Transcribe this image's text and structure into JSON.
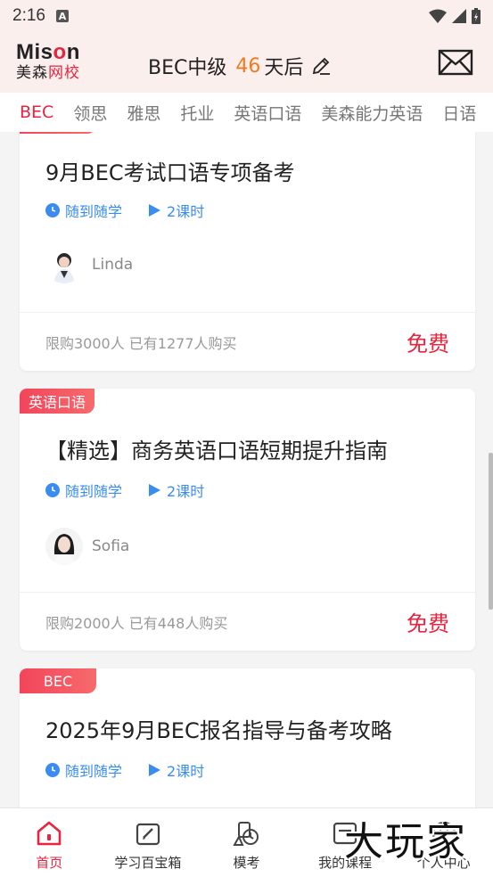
{
  "statusbar": {
    "time": "2:16",
    "a_icon": "A"
  },
  "header": {
    "logo_top": "Mison",
    "logo_bottom_a": "美森",
    "logo_bottom_b": "网校",
    "exam_name": "BEC中级",
    "days_number": "46",
    "days_suffix": "天后",
    "edit_icon": "pencil-icon",
    "mail_icon": "envelope-icon"
  },
  "tabs": [
    {
      "label": "BEC",
      "active": true
    },
    {
      "label": "领思"
    },
    {
      "label": "雅思"
    },
    {
      "label": "托业"
    },
    {
      "label": "英语口语"
    },
    {
      "label": "美森能力英语"
    },
    {
      "label": "日语"
    }
  ],
  "courses": [
    {
      "badge": "",
      "title": "9月BEC考试口语专项备考",
      "mode": "随到随学",
      "hours": "2课时",
      "teacher": "Linda",
      "sale": "限购3000人 已有1277人购买",
      "price": "免费"
    },
    {
      "badge": "英语口语",
      "title": "【精选】商务英语口语短期提升指南",
      "mode": "随到随学",
      "hours": "2课时",
      "teacher": "Sofia",
      "sale": "限购2000人 已有448人购买",
      "price": "免费"
    },
    {
      "badge": "BEC",
      "title": "2025年9月BEC报名指导与备考攻略",
      "mode": "随到随学",
      "hours": "2课时"
    }
  ],
  "nav": [
    {
      "label": "首页",
      "icon": "home-icon",
      "active": true
    },
    {
      "label": "学习百宝箱",
      "icon": "toolbox-icon"
    },
    {
      "label": "模考",
      "icon": "exam-icon"
    },
    {
      "label": "我的课程",
      "icon": "course-icon"
    },
    {
      "label": "个人中心",
      "icon": "profile-icon"
    }
  ],
  "watermark": "大玩家",
  "colors": {
    "accent": "#e8243f",
    "blue": "#3a8cf0",
    "orange": "#f07a1d",
    "header_bg": "#fbefee"
  }
}
